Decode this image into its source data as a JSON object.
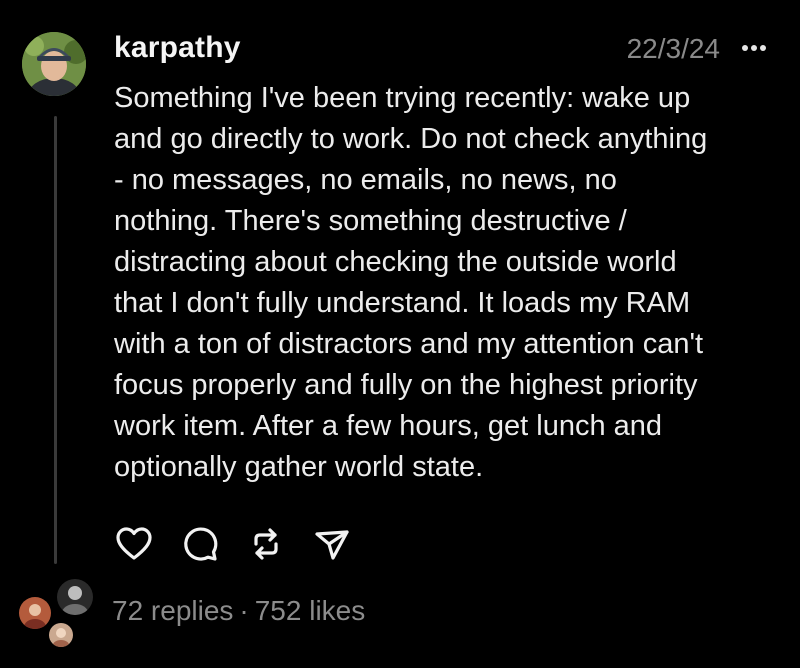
{
  "post": {
    "author": "karpathy",
    "timestamp": "22/3/24",
    "text": "Something I've been trying recently: wake up\nand go directly to work. Do not check anything\n- no messages, no emails, no news, no\nnothing. There's something destructive /\ndistracting about checking the outside world\nthat I don't fully understand. It loads my RAM\nwith a ton of distractors and my attention can't\nfocus properly and fully on the highest priority\nwork item. After a few hours, get lunch and\noptionally gather world state."
  },
  "actions": [
    {
      "icon": "heart-icon"
    },
    {
      "icon": "comment-icon"
    },
    {
      "icon": "repost-icon"
    },
    {
      "icon": "share-icon"
    }
  ],
  "stats": {
    "replies": "72 replies",
    "separator": "·",
    "likes": "752 likes"
  },
  "colors": {
    "background": "#000000",
    "text": "#ececec",
    "muted": "#8a8a8a",
    "thread_line": "#3a3a3a"
  }
}
